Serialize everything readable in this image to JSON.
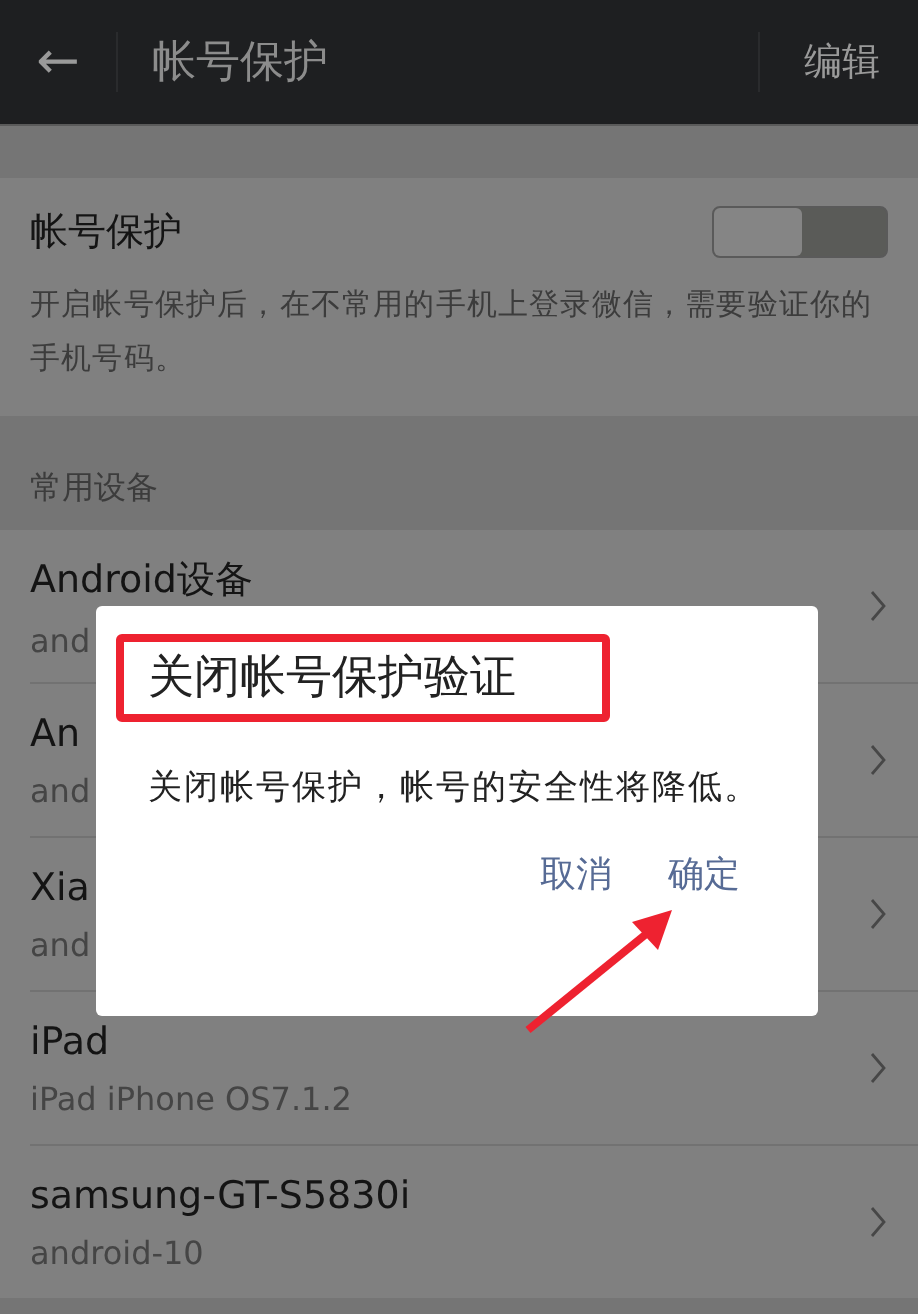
{
  "header": {
    "back_icon": "←",
    "title": "帐号保护",
    "action": "编辑"
  },
  "protection": {
    "label": "帐号保护",
    "on": false,
    "description": "开启帐号保护后，在不常用的手机上登录微信，需要验证你的手机号码。"
  },
  "devices_section": {
    "title": "常用设备",
    "items": [
      {
        "name": "Android设备",
        "detail": "and"
      },
      {
        "name": "An",
        "detail": "and"
      },
      {
        "name": "Xia",
        "detail": "and"
      },
      {
        "name": "iPad",
        "detail": "iPad iPhone OS7.1.2"
      },
      {
        "name": "samsung-GT-S5830i",
        "detail": "android-10"
      }
    ]
  },
  "dialog": {
    "title": "关闭帐号保护验证",
    "title_highlighted": true,
    "message": "关闭帐号保护，帐号的安全性将降低。",
    "buttons": [
      {
        "label": "取消",
        "arrow": false
      },
      {
        "label": "确定",
        "arrow": true
      }
    ]
  }
}
